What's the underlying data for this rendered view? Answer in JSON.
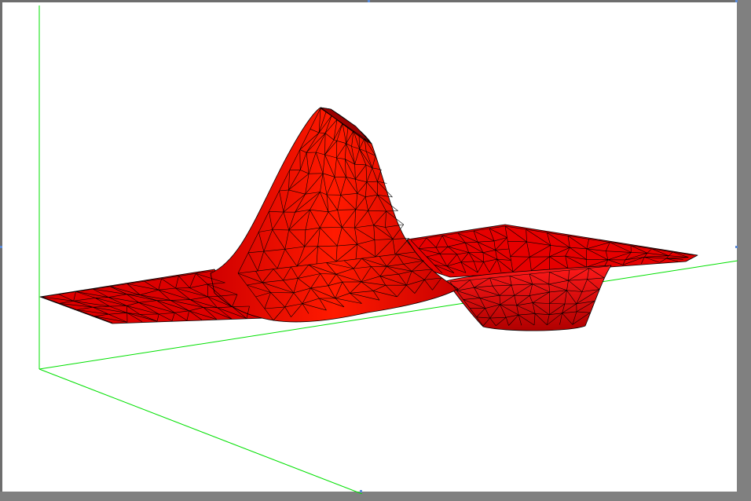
{
  "viewer": {
    "background": "#ffffff",
    "frame_color": "#808080",
    "axis_color": "#00e000",
    "surface_color": "#ff0000",
    "mesh_line_color": "#000000",
    "selection_handle_color": "#5a8ad8"
  }
}
